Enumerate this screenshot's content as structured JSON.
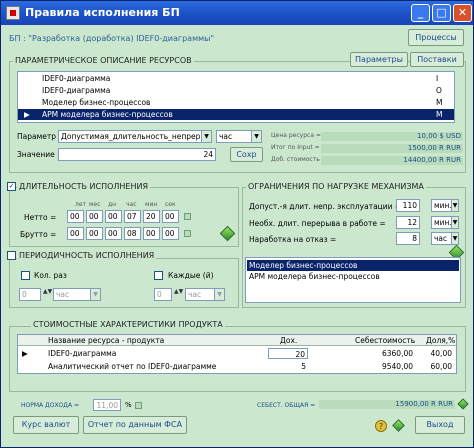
{
  "window": {
    "title": "Правила исполнения БП",
    "min": "_",
    "max": "□",
    "close": "✕"
  },
  "header": {
    "bp_label": "БП : \"Разработка (доработка) IDEF0-диаграммы\"",
    "processes_btn": "Процессы",
    "params_btn": "Параметры",
    "supplies_btn": "Поставки"
  },
  "resources": {
    "legend": "ПАРАМЕТРИЧЕСКОЕ ОПИСАНИЕ РЕСУРСОВ",
    "rows": [
      {
        "name": "IDEF0-диаграмма",
        "code": "I",
        "selected": false
      },
      {
        "name": "IDEF0-диаграмма",
        "code": "O",
        "selected": false
      },
      {
        "name": "Моделер бизнес-процессов",
        "code": "M",
        "selected": false
      },
      {
        "name": "АРМ моделера бизнес-процессов",
        "code": "M",
        "selected": true
      }
    ],
    "param_label": "Параметр",
    "param_value": "Допустимая_длительность_непреры",
    "unit_value": "час",
    "value_label": "Значение",
    "value": "24",
    "save_btn": "Сохр",
    "price_label": "Цена ресурса =",
    "price_value": "10,00 $ USD",
    "total_in_label": "Итог по Input =",
    "total_in_value": "1500,00 R RUR",
    "add_cost_label": "Доб. стоимость =",
    "add_cost_value": "14400,00 R RUR"
  },
  "duration": {
    "legend": "ДЛИТЕЛЬНОСТЬ ИСПОЛНЕНИЯ",
    "checked": true,
    "cols": [
      "лет",
      "мес",
      "дн",
      "час",
      "мин",
      "сек"
    ],
    "net_label": "Нетто =",
    "net": [
      "00",
      "00",
      "00",
      "07",
      "20",
      "00"
    ],
    "gross_label": "Брутто =",
    "gross": [
      "00",
      "00",
      "00",
      "08",
      "00",
      "00"
    ]
  },
  "periodicity": {
    "legend": "ПЕРИОДИЧНОСТЬ ИСПОЛНЕНИЯ",
    "checked": false,
    "count_label": "Кол. раз",
    "count_val": "0",
    "count_unit": "час",
    "each_label": "Каждые (й)",
    "each_val": "0",
    "each_unit": "час"
  },
  "limits": {
    "legend": "ОГРАНИЧЕНИЯ ПО НАГРУЗКЕ МЕХАНИЗМА",
    "rows": [
      {
        "label": "Допуст.-я длит. непр. эксплуатации =",
        "value": "110",
        "unit": "мин."
      },
      {
        "label": "Необх. длит. перерыва в работе =",
        "value": "12",
        "unit": "мин."
      },
      {
        "label": "Наработка на отказ =",
        "value": "8",
        "unit": "час"
      }
    ],
    "list": [
      {
        "text": "Моделер бизнес-процессов",
        "selected": true
      },
      {
        "text": "АРМ моделера бизнес-процессов",
        "selected": false
      }
    ]
  },
  "costs": {
    "legend": "СТОИМОСТНЫЕ ХАРАКТЕРИСТИКИ ПРОДУКТА",
    "headers": [
      "Название ресурса - продукта",
      "Дох.",
      "Себестоимость",
      "Доля,%"
    ],
    "rows": [
      {
        "name": "IDEF0-диаграмма",
        "dox": "20",
        "cost": "6360,00",
        "share": "40,00"
      },
      {
        "name": "Аналитический отчет по IDEF0-диаграмме",
        "dox": "5",
        "cost": "9540,00",
        "share": "60,00"
      }
    ],
    "norm_label": "НОРМА ДОХОДА =",
    "norm_value": "11,00",
    "norm_unit": "%",
    "total_label": "СЕБЕСТ. ОБЩАЯ =",
    "total_value": "15900,00 R RUR"
  },
  "footer": {
    "rates_btn": "Курс валют",
    "fsa_btn": "Отчет по данным ФСА",
    "exit_btn": "Выход"
  }
}
